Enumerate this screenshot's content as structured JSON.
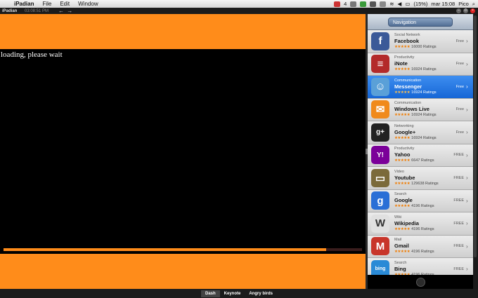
{
  "menubar": {
    "app": "iPadian",
    "items": [
      "File",
      "Edit",
      "Window"
    ],
    "battery": "(15%)",
    "clock": "mar 15:08",
    "user": "Pico",
    "badge": "4"
  },
  "ipadian_bar": {
    "title": "iPadian",
    "time": "03:08:51 PM",
    "nav": "← →"
  },
  "main": {
    "loading_text": "loading, please wait",
    "progress": 0.9
  },
  "navigation": {
    "header": "Navigation",
    "apps": [
      {
        "category": "Social Network",
        "name": "Facebook",
        "stars": "★★★★★",
        "ratings": "16000 Ratings",
        "price": "Free",
        "icon": "facebook-icon",
        "glyph": "f",
        "color": "#3b5998",
        "selected": false
      },
      {
        "category": "Productivity",
        "name": "iNote",
        "stars": "★★★★★",
        "ratings": "16924 Ratings",
        "price": "Free",
        "icon": "note-icon",
        "glyph": "≡",
        "color": "#b32a2a",
        "selected": false
      },
      {
        "category": "Communication",
        "name": "Messenger",
        "stars": "★★★★★",
        "ratings": "16924 Ratings",
        "price": "Free",
        "icon": "messenger-icon",
        "glyph": "☺",
        "color": "#5aa0d8",
        "selected": true
      },
      {
        "category": "Communication",
        "name": "Windows Live",
        "stars": "★★★★★",
        "ratings": "16924 Ratings",
        "price": "Free",
        "icon": "mail-icon",
        "glyph": "✉",
        "color": "#f08a1c",
        "selected": false
      },
      {
        "category": "Networking",
        "name": "Google+",
        "stars": "★★★★★",
        "ratings": "16924 Ratings",
        "price": "Free",
        "icon": "google-plus-icon",
        "glyph": "g+",
        "color": "#222",
        "selected": false
      },
      {
        "category": "Productivity",
        "name": "Yahoo",
        "stars": "★★★★★",
        "ratings": "6647 Ratings",
        "price": "FREE",
        "icon": "yahoo-icon",
        "glyph": "Y!",
        "color": "#7b0099",
        "selected": false
      },
      {
        "category": "Video",
        "name": "Youtube",
        "stars": "★★★★★",
        "ratings": "129638 Ratings",
        "price": "FREE",
        "icon": "youtube-icon",
        "glyph": "▭",
        "color": "#7b6a3a",
        "selected": false
      },
      {
        "category": "Search",
        "name": "Google",
        "stars": "★★★★★",
        "ratings": "4196 Ratings",
        "price": "FREE",
        "icon": "search-icon",
        "glyph": "g",
        "color": "#2a6fd6",
        "selected": false
      },
      {
        "category": "Wiki",
        "name": "Wikipedia",
        "stars": "★★★★★",
        "ratings": "4196 Ratings",
        "price": "FREE",
        "icon": "wikipedia-icon",
        "glyph": "W",
        "color": "#e0e0e0",
        "selected": false
      },
      {
        "category": "Mail",
        "name": "Gmail",
        "stars": "★★★★★",
        "ratings": "4196 Ratings",
        "price": "FREE",
        "icon": "gmail-icon",
        "glyph": "M",
        "color": "#c8352a",
        "selected": false
      },
      {
        "category": "Search",
        "name": "Bing",
        "stars": "★★★★★",
        "ratings": "4196 Ratings",
        "price": "FREE",
        "icon": "bing-icon",
        "glyph": "bing",
        "color": "#2a8ad6",
        "selected": false
      }
    ]
  },
  "dock": {
    "tabs": [
      "Dash",
      "Keynote",
      "Angry birds"
    ]
  }
}
